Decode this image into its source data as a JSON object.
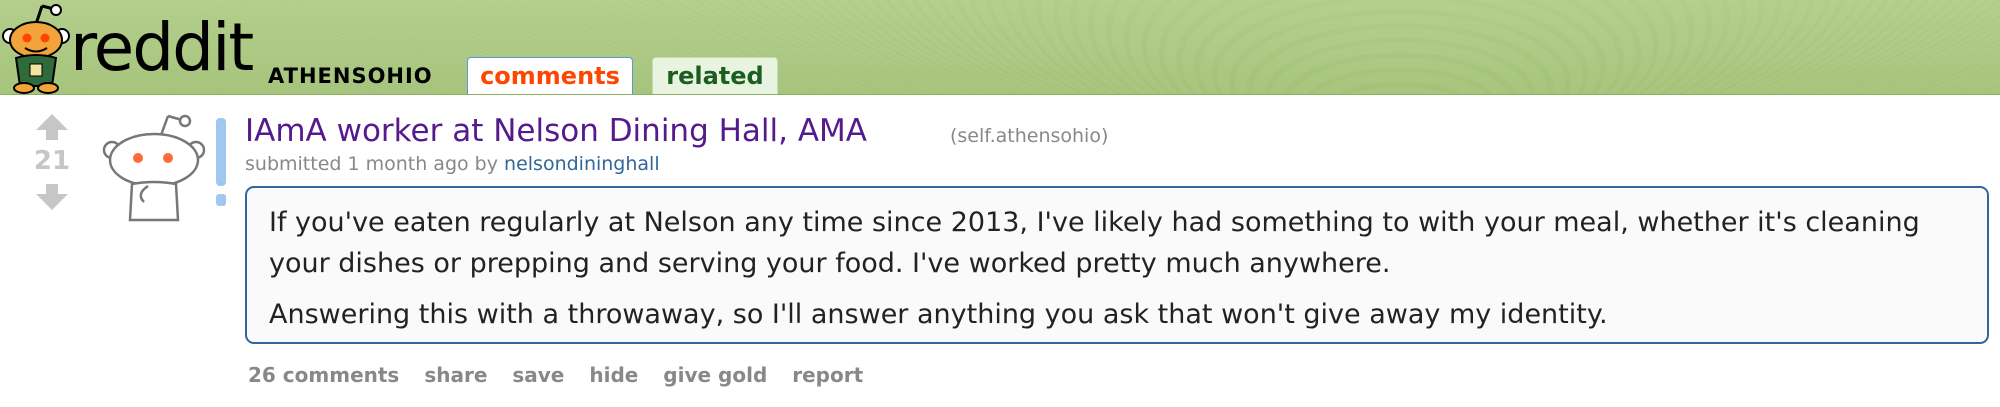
{
  "header": {
    "site_name": "reddit",
    "subreddit": "ATHENSOHIO",
    "tabs": [
      {
        "label": "comments",
        "active": true
      },
      {
        "label": "related",
        "active": false
      }
    ],
    "colors": {
      "banner": "#a8c67e",
      "active_tab_text": "#ff4500",
      "related_tab_text": "#1b5e20"
    }
  },
  "post": {
    "score": "21",
    "title": "IAmA worker at Nelson Dining Hall, AMA",
    "domain": "(self.athensohio)",
    "tagline": {
      "prefix": "submitted 1 month ago by ",
      "author": "nelsondininghall"
    },
    "selftext": [
      "If you've eaten regularly at Nelson any time since 2013, I've likely had something to with your meal, whether it's cleaning your dishes or prepping and serving your food. I've worked pretty much anywhere.",
      "Answering this with a throwaway, so I'll answer anything you ask that won't give away my identity."
    ],
    "buttons": {
      "comments": "26 comments",
      "share": "share",
      "save": "save",
      "hide": "hide",
      "give_gold": "give gold",
      "report": "report"
    },
    "icons": {
      "upvote": "upvote-arrow-icon",
      "downvote": "downvote-arrow-icon",
      "thumbnail": "self-post-alien-icon"
    },
    "colors": {
      "title": "#551a8b",
      "author": "#336699",
      "selftext_border": "#336699"
    }
  }
}
